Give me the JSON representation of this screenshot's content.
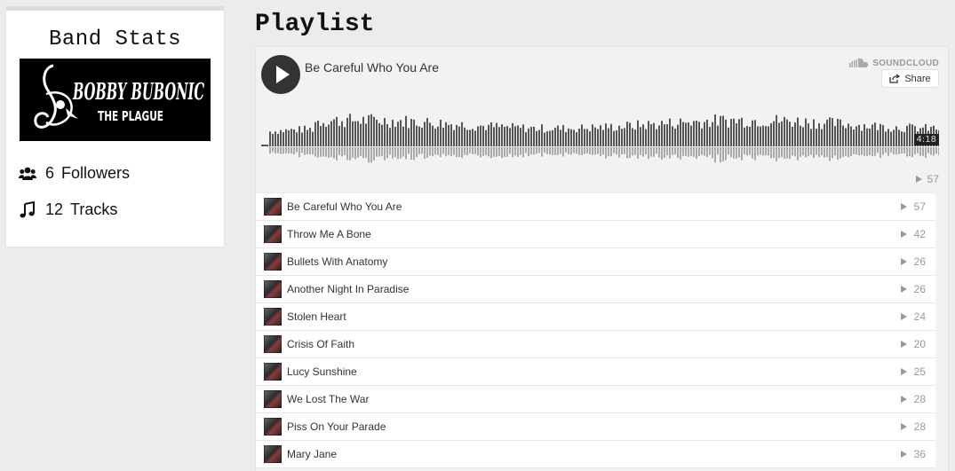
{
  "sidebar": {
    "title": "Band Stats",
    "logo": {
      "line1": "BOBBY BUBONIC",
      "line2": "THE PLAGUE"
    },
    "stats": [
      {
        "icon": "users-icon",
        "count": "6",
        "label": "Followers"
      },
      {
        "icon": "music-note-icon",
        "count": "12",
        "label": "Tracks"
      }
    ]
  },
  "playlist": {
    "heading": "Playlist",
    "player": {
      "current_title": "Be Careful Who You Are",
      "brand": "SOUNDCLOUD",
      "share_label": "Share",
      "duration": "4:18",
      "plays": "57",
      "play_icon": "play-icon"
    },
    "tracks": [
      {
        "title": "Be Careful Who You Are",
        "plays": "57"
      },
      {
        "title": "Throw Me A Bone",
        "plays": "42"
      },
      {
        "title": "Bullets With Anatomy",
        "plays": "26"
      },
      {
        "title": "Another Night In Paradise",
        "plays": "26"
      },
      {
        "title": "Stolen Heart",
        "plays": "24"
      },
      {
        "title": "Crisis Of Faith",
        "plays": "20"
      },
      {
        "title": "Lucy Sunshine",
        "plays": "25"
      },
      {
        "title": "We Lost The War",
        "plays": "28"
      },
      {
        "title": "Piss On Your Parade",
        "plays": "28"
      },
      {
        "title": "Mary Jane",
        "plays": "36"
      }
    ]
  },
  "colors": {
    "background": "#ececec",
    "player_bg": "#f2f2f2",
    "waveform_top": "#555555",
    "waveform_bottom": "#aaaaaa",
    "accent_dark": "#333333"
  }
}
